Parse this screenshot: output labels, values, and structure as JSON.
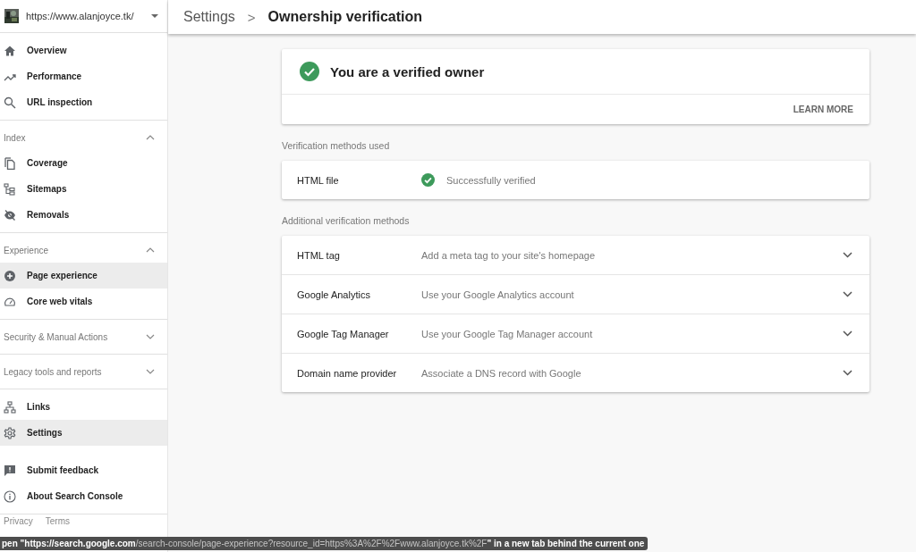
{
  "property": {
    "url": "https://www.alanjoyce.tk/"
  },
  "breadcrumb": {
    "parent": "Settings",
    "separator": ">",
    "current": "Ownership verification"
  },
  "sidebar": [
    {
      "items": [
        {
          "label": "Overview",
          "selected": false
        },
        {
          "label": "Performance",
          "selected": false
        },
        {
          "label": "URL inspection",
          "selected": false
        }
      ]
    },
    {
      "title": "Index",
      "expanded": true,
      "items": [
        {
          "label": "Coverage",
          "selected": false
        },
        {
          "label": "Sitemaps",
          "selected": false
        },
        {
          "label": "Removals",
          "selected": false
        }
      ]
    },
    {
      "title": "Experience",
      "expanded": true,
      "items": [
        {
          "label": "Page experience",
          "selected": true
        },
        {
          "label": "Core web vitals",
          "selected": false
        }
      ]
    },
    {
      "title": "Security & Manual Actions",
      "expanded": false
    },
    {
      "title": "Legacy tools and reports",
      "expanded": false
    },
    {
      "items": [
        {
          "label": "Links",
          "selected": false
        },
        {
          "label": "Settings",
          "selected": true
        }
      ]
    },
    {
      "items": [
        {
          "label": "Submit feedback",
          "selected": false
        },
        {
          "label": "About Search Console",
          "selected": false
        }
      ]
    }
  ],
  "footer_links": [
    "Privacy",
    "Terms"
  ],
  "owner_card": {
    "title": "You are a verified owner",
    "action": "LEARN MORE"
  },
  "used_label": "Verification methods used",
  "used_methods": [
    {
      "name": "HTML file",
      "status": "Successfully verified"
    }
  ],
  "additional_label": "Additional verification methods",
  "additional_methods": [
    {
      "name": "HTML tag",
      "description": "Add a meta tag to your site's homepage",
      "expanded": false
    },
    {
      "name": "Google Analytics",
      "description": "Use your Google Analytics account",
      "expanded": false
    },
    {
      "name": "Google Tag Manager",
      "description": "Use your Google Tag Manager account",
      "expanded": false
    },
    {
      "name": "Domain name provider",
      "description": "Associate a DNS record with Google",
      "expanded": false
    }
  ],
  "status_tooltip": "**pen \"https://search.google.com**/search-console/page-experience?resource_id=https%3A%2F%2Fwww.alanjoyce.tk%2F**\" in a new tab behind the current one**"
}
